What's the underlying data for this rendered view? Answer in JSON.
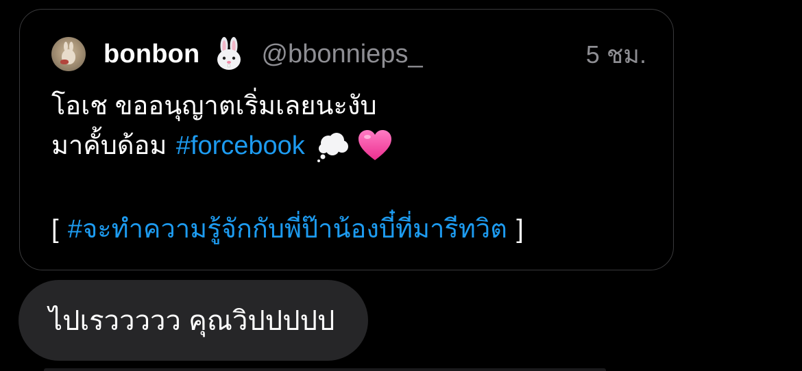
{
  "quoted_post": {
    "author": {
      "display_name": "bonbon",
      "name_emoji": "rabbit-face-emoji",
      "handle": "@bbonnieps_",
      "avatar_icon": "bunny-plush-avatar"
    },
    "timestamp": "5 ชม.",
    "body": {
      "line1": "โอเช ขออนุญาตเริ่มเลยนะงับ",
      "line2_text": "มาคั้บด้อม",
      "line2_hashtag": "#forcebook",
      "line2_emojis": [
        "thought-balloon-emoji",
        "pink-heart-emoji"
      ],
      "line3_open_bracket": "[",
      "line3_hashtag": "#จะทำความรู้จักกับพี่ป๊าน้องบี๋ที่มารีทวิต",
      "line3_close_bracket": "]"
    }
  },
  "reply_message": {
    "text": "ไปเรววววว คุณวิปปปปป"
  },
  "colors": {
    "background": "#000000",
    "card_border": "#3a3a3c",
    "muted_text": "#8e8e93",
    "hashtag": "#1d9bf0",
    "bubble": "#262628"
  }
}
